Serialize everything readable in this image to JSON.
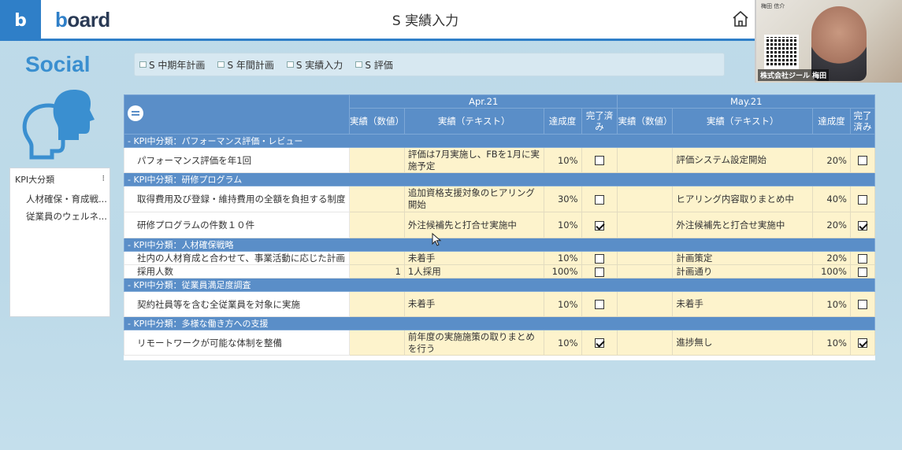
{
  "app": {
    "logo_letter": "b",
    "brand_b": "b",
    "brand_rest": "oard",
    "page_title": "S 実績入力"
  },
  "video": {
    "caption": "株式会社ジール 梅田",
    "small_name": "梅田 信介"
  },
  "section": {
    "title": "Social"
  },
  "tabs": [
    {
      "label": "S 中期年計画"
    },
    {
      "label": "S 年間計画"
    },
    {
      "label": "S 実績入力"
    },
    {
      "label": "S 評価"
    }
  ],
  "filter": {
    "header": "KPI大分類",
    "menu_glyph": "⁝",
    "items": [
      "人材確保・育成戦...",
      "従業員のウェルネ..."
    ]
  },
  "grid": {
    "months": [
      "Apr.21",
      "May.21"
    ],
    "columns": {
      "actual_num": "実績（数値）",
      "actual_text": "実績（テキスト）",
      "rate": "達成度",
      "done": "完了済み"
    },
    "groups": [
      {
        "title": "- KPI中分類：パフォーマンス評価・レビュー",
        "rows": [
          {
            "label": "パフォーマンス評価を年1回",
            "apr": {
              "num": "",
              "text": "評価は7月実施し、FBを1月に実施予定",
              "rate": "10%",
              "done": false
            },
            "may": {
              "num": "",
              "text": "評価システム設定開始",
              "rate": "20%",
              "done": false
            }
          }
        ]
      },
      {
        "title": "- KPI中分類：研修プログラム",
        "rows": [
          {
            "label": "取得費用及び登録・維持費用の全額を負担する制度",
            "apr": {
              "num": "",
              "text": "追加資格支援対象のヒアリング開始",
              "rate": "30%",
              "done": false
            },
            "may": {
              "num": "",
              "text": "ヒアリング内容取りまとめ中",
              "rate": "40%",
              "done": false
            }
          },
          {
            "label": "研修プログラムの件数１０件",
            "apr": {
              "num": "",
              "text": "外注候補先と打合せ実施中",
              "rate": "10%",
              "done": true
            },
            "may": {
              "num": "",
              "text": "外注候補先と打合せ実施中",
              "rate": "20%",
              "done": true
            }
          }
        ]
      },
      {
        "title": "- KPI中分類：人材確保戦略",
        "rows": [
          {
            "label": "社内の人材育成と合わせて、事業活動に応じた計画",
            "apr": {
              "num": "",
              "text": "未着手",
              "rate": "10%",
              "done": false
            },
            "may": {
              "num": "",
              "text": "計画策定",
              "rate": "20%",
              "done": false
            }
          },
          {
            "label": "採用人数",
            "apr": {
              "num": "1",
              "text": "1人採用",
              "rate": "100%",
              "done": false
            },
            "may": {
              "num": "",
              "text": "計画通り",
              "rate": "100%",
              "done": false
            }
          }
        ]
      },
      {
        "title": "- KPI中分類：従業員満足度調査",
        "rows": [
          {
            "label": "契約社員等を含む全従業員を対象に実施",
            "apr": {
              "num": "",
              "text": "未着手",
              "rate": "10%",
              "done": false
            },
            "may": {
              "num": "",
              "text": "未着手",
              "rate": "10%",
              "done": false
            }
          }
        ]
      },
      {
        "title": "- KPI中分類：多様な働き方への支援",
        "rows": [
          {
            "label": "リモートワークが可能な体制を整備",
            "apr": {
              "num": "",
              "text": "前年度の実施施策の取りまとめを行う",
              "rate": "10%",
              "done": true
            },
            "may": {
              "num": "",
              "text": "進捗無し",
              "rate": "10%",
              "done": true
            }
          }
        ]
      }
    ]
  }
}
